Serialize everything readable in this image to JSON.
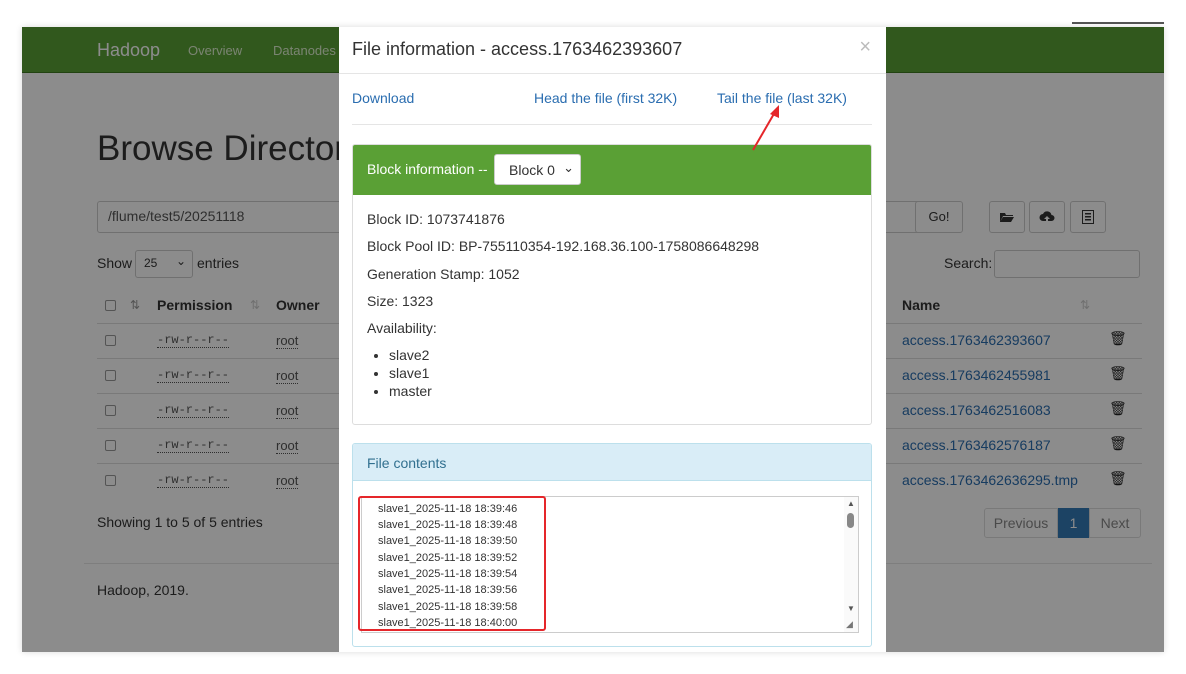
{
  "navbar": {
    "brand": "Hadoop",
    "links": [
      "Overview",
      "Datanodes"
    ]
  },
  "browse": {
    "title": "Browse Directory",
    "path": "/flume/test5/20251118",
    "go_label": "Go!",
    "show_label": "Show",
    "entries_value": "25",
    "entries_label": "entries",
    "search_label": "Search:",
    "columns": {
      "permission": "Permission",
      "owner": "Owner",
      "name": "Name"
    },
    "rows": [
      {
        "permission": "-rw-r--r--",
        "owner": "root",
        "name": "access.1763462393607"
      },
      {
        "permission": "-rw-r--r--",
        "owner": "root",
        "name": "access.1763462455981"
      },
      {
        "permission": "-rw-r--r--",
        "owner": "root",
        "name": "access.1763462516083"
      },
      {
        "permission": "-rw-r--r--",
        "owner": "root",
        "name": "access.1763462576187"
      },
      {
        "permission": "-rw-r--r--",
        "owner": "root",
        "name": "access.1763462636295.tmp"
      }
    ],
    "showing": "Showing 1 to 5 of 5 entries",
    "pagination": {
      "previous": "Previous",
      "current": "1",
      "next": "Next"
    },
    "footer": "Hadoop, 2019."
  },
  "modal": {
    "title": "File information - access.1763462393607",
    "close": "×",
    "links": {
      "download": "Download",
      "head": "Head the file (first 32K)",
      "tail": "Tail the file (last 32K)"
    },
    "block": {
      "label": "Block information --",
      "selected": "Block 0",
      "block_id": "Block ID: 1073741876",
      "pool_id": "Block Pool ID: BP-755110354-192.168.36.100-1758086648298",
      "generation": "Generation Stamp: 1052",
      "size": "Size: 1323",
      "availability_label": "Availability:",
      "availability": [
        "slave2",
        "slave1",
        "master"
      ]
    },
    "contents": {
      "title": "File contents",
      "lines": [
        "slave1_2025-11-18 18:39:46",
        "slave1_2025-11-18 18:39:48",
        "slave1_2025-11-18 18:39:50",
        "slave1_2025-11-18 18:39:52",
        "slave1_2025-11-18 18:39:54",
        "slave1_2025-11-18 18:39:56",
        "slave1_2025-11-18 18:39:58",
        "slave1_2025-11-18 18:40:00"
      ]
    }
  },
  "colors": {
    "navbar": "#5aa035",
    "link": "#2a6db0",
    "annotation": "#e5262a",
    "contents_header": "#d9edf7"
  }
}
